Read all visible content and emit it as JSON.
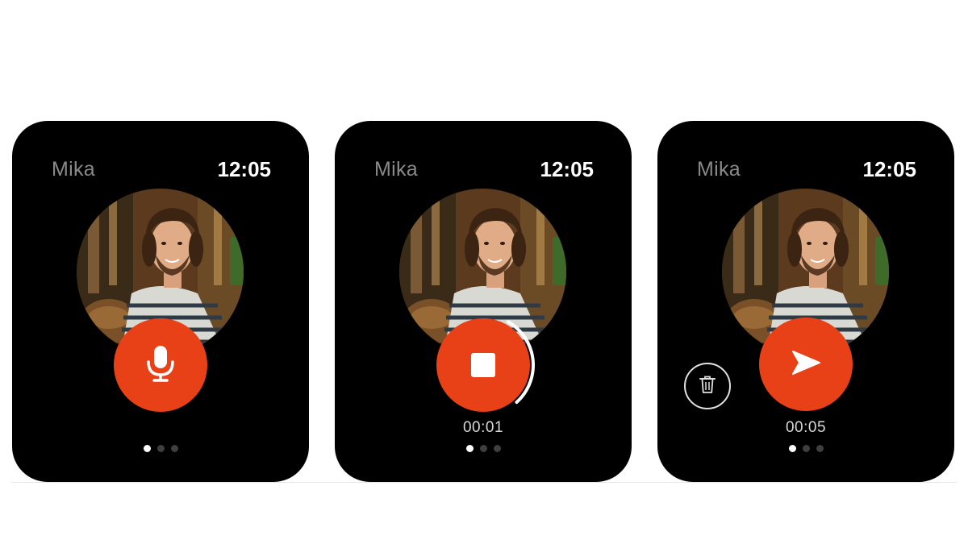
{
  "colors": {
    "accent": "#e84118",
    "background": "#000000",
    "name_text": "#8a8a8a",
    "clock_text": "#ffffff"
  },
  "screens": [
    {
      "contact_name": "Mika",
      "time": "12:05",
      "action_button": {
        "icon": "microphone-icon"
      },
      "page_count": 3,
      "active_page": 1
    },
    {
      "contact_name": "Mika",
      "time": "12:05",
      "action_button": {
        "icon": "stop-icon"
      },
      "recording_progress": 0.3,
      "timer": "00:01",
      "page_count": 3,
      "active_page": 1
    },
    {
      "contact_name": "Mika",
      "time": "12:05",
      "action_button": {
        "icon": "send-icon"
      },
      "secondary_button": {
        "icon": "trash-icon"
      },
      "timer": "00:05",
      "page_count": 3,
      "active_page": 1
    }
  ]
}
